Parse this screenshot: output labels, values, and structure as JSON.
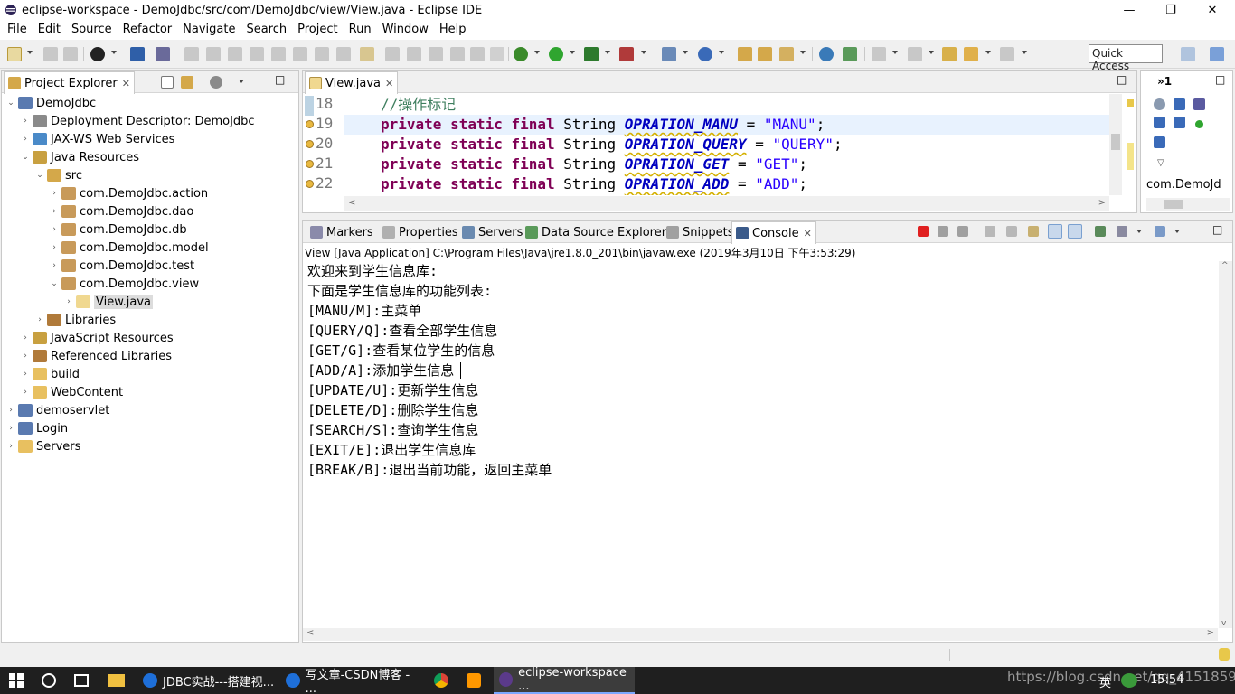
{
  "window": {
    "title": "eclipse-workspace - DemoJdbc/src/com/DemoJdbc/view/View.java - Eclipse IDE",
    "minimize": "—",
    "restore": "❐",
    "close": "✕"
  },
  "menu": [
    "File",
    "Edit",
    "Source",
    "Refactor",
    "Navigate",
    "Search",
    "Project",
    "Run",
    "Window",
    "Help"
  ],
  "toolbar": {
    "quick_access_label": "Quick Access"
  },
  "project_explorer": {
    "tab_label": "Project Explorer",
    "tab_close": "✕",
    "tree": [
      {
        "label": "DemoJdbc",
        "arrow": "⌄",
        "icon": "project-icon"
      },
      {
        "label": "Deployment Descriptor: DemoJdbc",
        "arrow": "›",
        "icon": "descriptor-icon"
      },
      {
        "label": "JAX-WS Web Services",
        "arrow": "›",
        "icon": "webservice-icon"
      },
      {
        "label": "Java Resources",
        "arrow": "⌄",
        "icon": "java-resources-icon"
      },
      {
        "label": "src",
        "arrow": "⌄",
        "icon": "source-folder-icon"
      },
      {
        "label": "com.DemoJdbc.action",
        "arrow": "›",
        "icon": "package-icon"
      },
      {
        "label": "com.DemoJdbc.dao",
        "arrow": "›",
        "icon": "package-icon"
      },
      {
        "label": "com.DemoJdbc.db",
        "arrow": "›",
        "icon": "package-icon"
      },
      {
        "label": "com.DemoJdbc.model",
        "arrow": "›",
        "icon": "package-icon"
      },
      {
        "label": "com.DemoJdbc.test",
        "arrow": "›",
        "icon": "package-icon"
      },
      {
        "label": "com.DemoJdbc.view",
        "arrow": "⌄",
        "icon": "package-icon"
      },
      {
        "label": "View.java",
        "arrow": "›",
        "icon": "java-file-icon"
      },
      {
        "label": "Libraries",
        "arrow": "›",
        "icon": "libraries-icon"
      },
      {
        "label": "JavaScript Resources",
        "arrow": "›",
        "icon": "js-resources-icon"
      },
      {
        "label": "Referenced Libraries",
        "arrow": "›",
        "icon": "libraries-icon"
      },
      {
        "label": "build",
        "arrow": "›",
        "icon": "folder-icon"
      },
      {
        "label": "WebContent",
        "arrow": "›",
        "icon": "folder-icon"
      },
      {
        "label": "demoservlet",
        "arrow": "›",
        "icon": "project-icon"
      },
      {
        "label": "Login",
        "arrow": "›",
        "icon": "project-icon"
      },
      {
        "label": "Servers",
        "arrow": "›",
        "icon": "folder-icon"
      }
    ]
  },
  "editor": {
    "tab_label": "View.java",
    "tab_close": "✕",
    "lines": [
      {
        "num": "18",
        "comment": "//操作标记"
      },
      {
        "num": "19",
        "mod": "private static final",
        "type": "String",
        "name": "OPRATION_MANU",
        "eq": "=",
        "value": "\"MANU\"",
        "end": ";"
      },
      {
        "num": "20",
        "mod": "private static final",
        "type": "String",
        "name": "OPRATION_QUERY",
        "eq": "=",
        "value": "\"QUERY\"",
        "end": ";"
      },
      {
        "num": "21",
        "mod": "private static final",
        "type": "String",
        "name": "OPRATION_GET",
        "eq": "=",
        "value": "\"GET\"",
        "end": ";"
      },
      {
        "num": "22",
        "mod": "private static final",
        "type": "String",
        "name": "OPRATION_ADD",
        "eq": "=",
        "value": "\"ADD\"",
        "end": ";"
      }
    ]
  },
  "outline": {
    "label": "com.DemoJd",
    "overflow": "»1"
  },
  "bottom_panel": {
    "tabs": [
      "Markers",
      "Properties",
      "Servers",
      "Data Source Explorer",
      "Snippets",
      "Console"
    ],
    "active_tab": "Console",
    "console_close": "✕",
    "status": "View [Java Application] C:\\Program Files\\Java\\jre1.8.0_201\\bin\\javaw.exe (2019年3月10日 下午3:53:29)",
    "output": [
      "欢迎来到学生信息库:",
      "下面是学生信息库的功能列表:",
      "[MANU/M]:主菜单",
      "[QUERY/Q]:查看全部学生信息",
      "[GET/G]:查看某位学生的信息",
      "[ADD/A]:添加学生信息",
      "[UPDATE/U]:更新学生信息",
      "[DELETE/D]:删除学生信息",
      "[SEARCH/S]:查询学生信息",
      "[EXIT/E]:退出学生信息库",
      "[BREAK/B]:退出当前功能，返回主菜单"
    ]
  },
  "taskbar": {
    "items": [
      {
        "label": "JDBC实战---搭建视...",
        "color": "#1e6fd9"
      },
      {
        "label": "写文章-CSDN博客 - ...",
        "color": "#1e6fd9"
      },
      {
        "label": "eclipse-workspace ...",
        "color": "#5b3a8a"
      }
    ],
    "watermark": "https://blog.csdn.net/qq_41518597",
    "ime": "英",
    "clock": "15:54"
  },
  "colors": {
    "keyword": "#7f0055",
    "field": "#0000c0",
    "string": "#2a00ff",
    "comment": "#3f7f5f"
  }
}
